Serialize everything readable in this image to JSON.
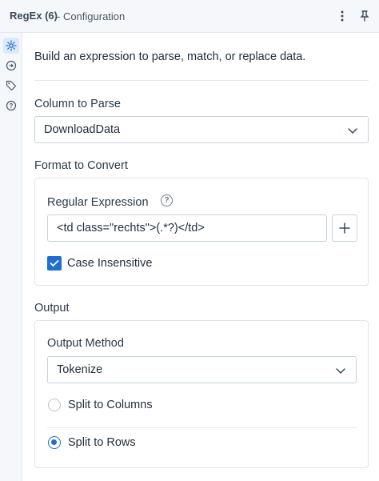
{
  "header": {
    "tool_name": "RegEx (6)",
    "subtitle": "- Configuration",
    "menu_icon": "more-vertical-icon",
    "pin_icon": "pin-icon"
  },
  "rail": {
    "items": [
      {
        "icon": "gear-icon",
        "active": true
      },
      {
        "icon": "circle-arrow-icon",
        "active": false
      },
      {
        "icon": "tag-icon",
        "active": false
      },
      {
        "icon": "help-circle-icon",
        "active": false
      }
    ]
  },
  "description": "Build an expression to parse, match, or replace data.",
  "column_to_parse": {
    "label": "Column to Parse",
    "selected": "DownloadData"
  },
  "format_to_convert": {
    "label": "Format to Convert",
    "regex_label": "Regular Expression",
    "regex_value": "<td class=\"rechts\">(.*?)</td>",
    "case_insensitive_label": "Case Insensitive",
    "case_insensitive": true
  },
  "output": {
    "label": "Output",
    "method_label": "Output Method",
    "method_selected": "Tokenize",
    "options": [
      {
        "label": "Split to Columns",
        "checked": false
      },
      {
        "label": "Split to Rows",
        "checked": true
      }
    ]
  },
  "colors": {
    "accent": "#1f6fd1",
    "rail_active_bg": "#dce9fb",
    "text": "#1f2d3d"
  }
}
